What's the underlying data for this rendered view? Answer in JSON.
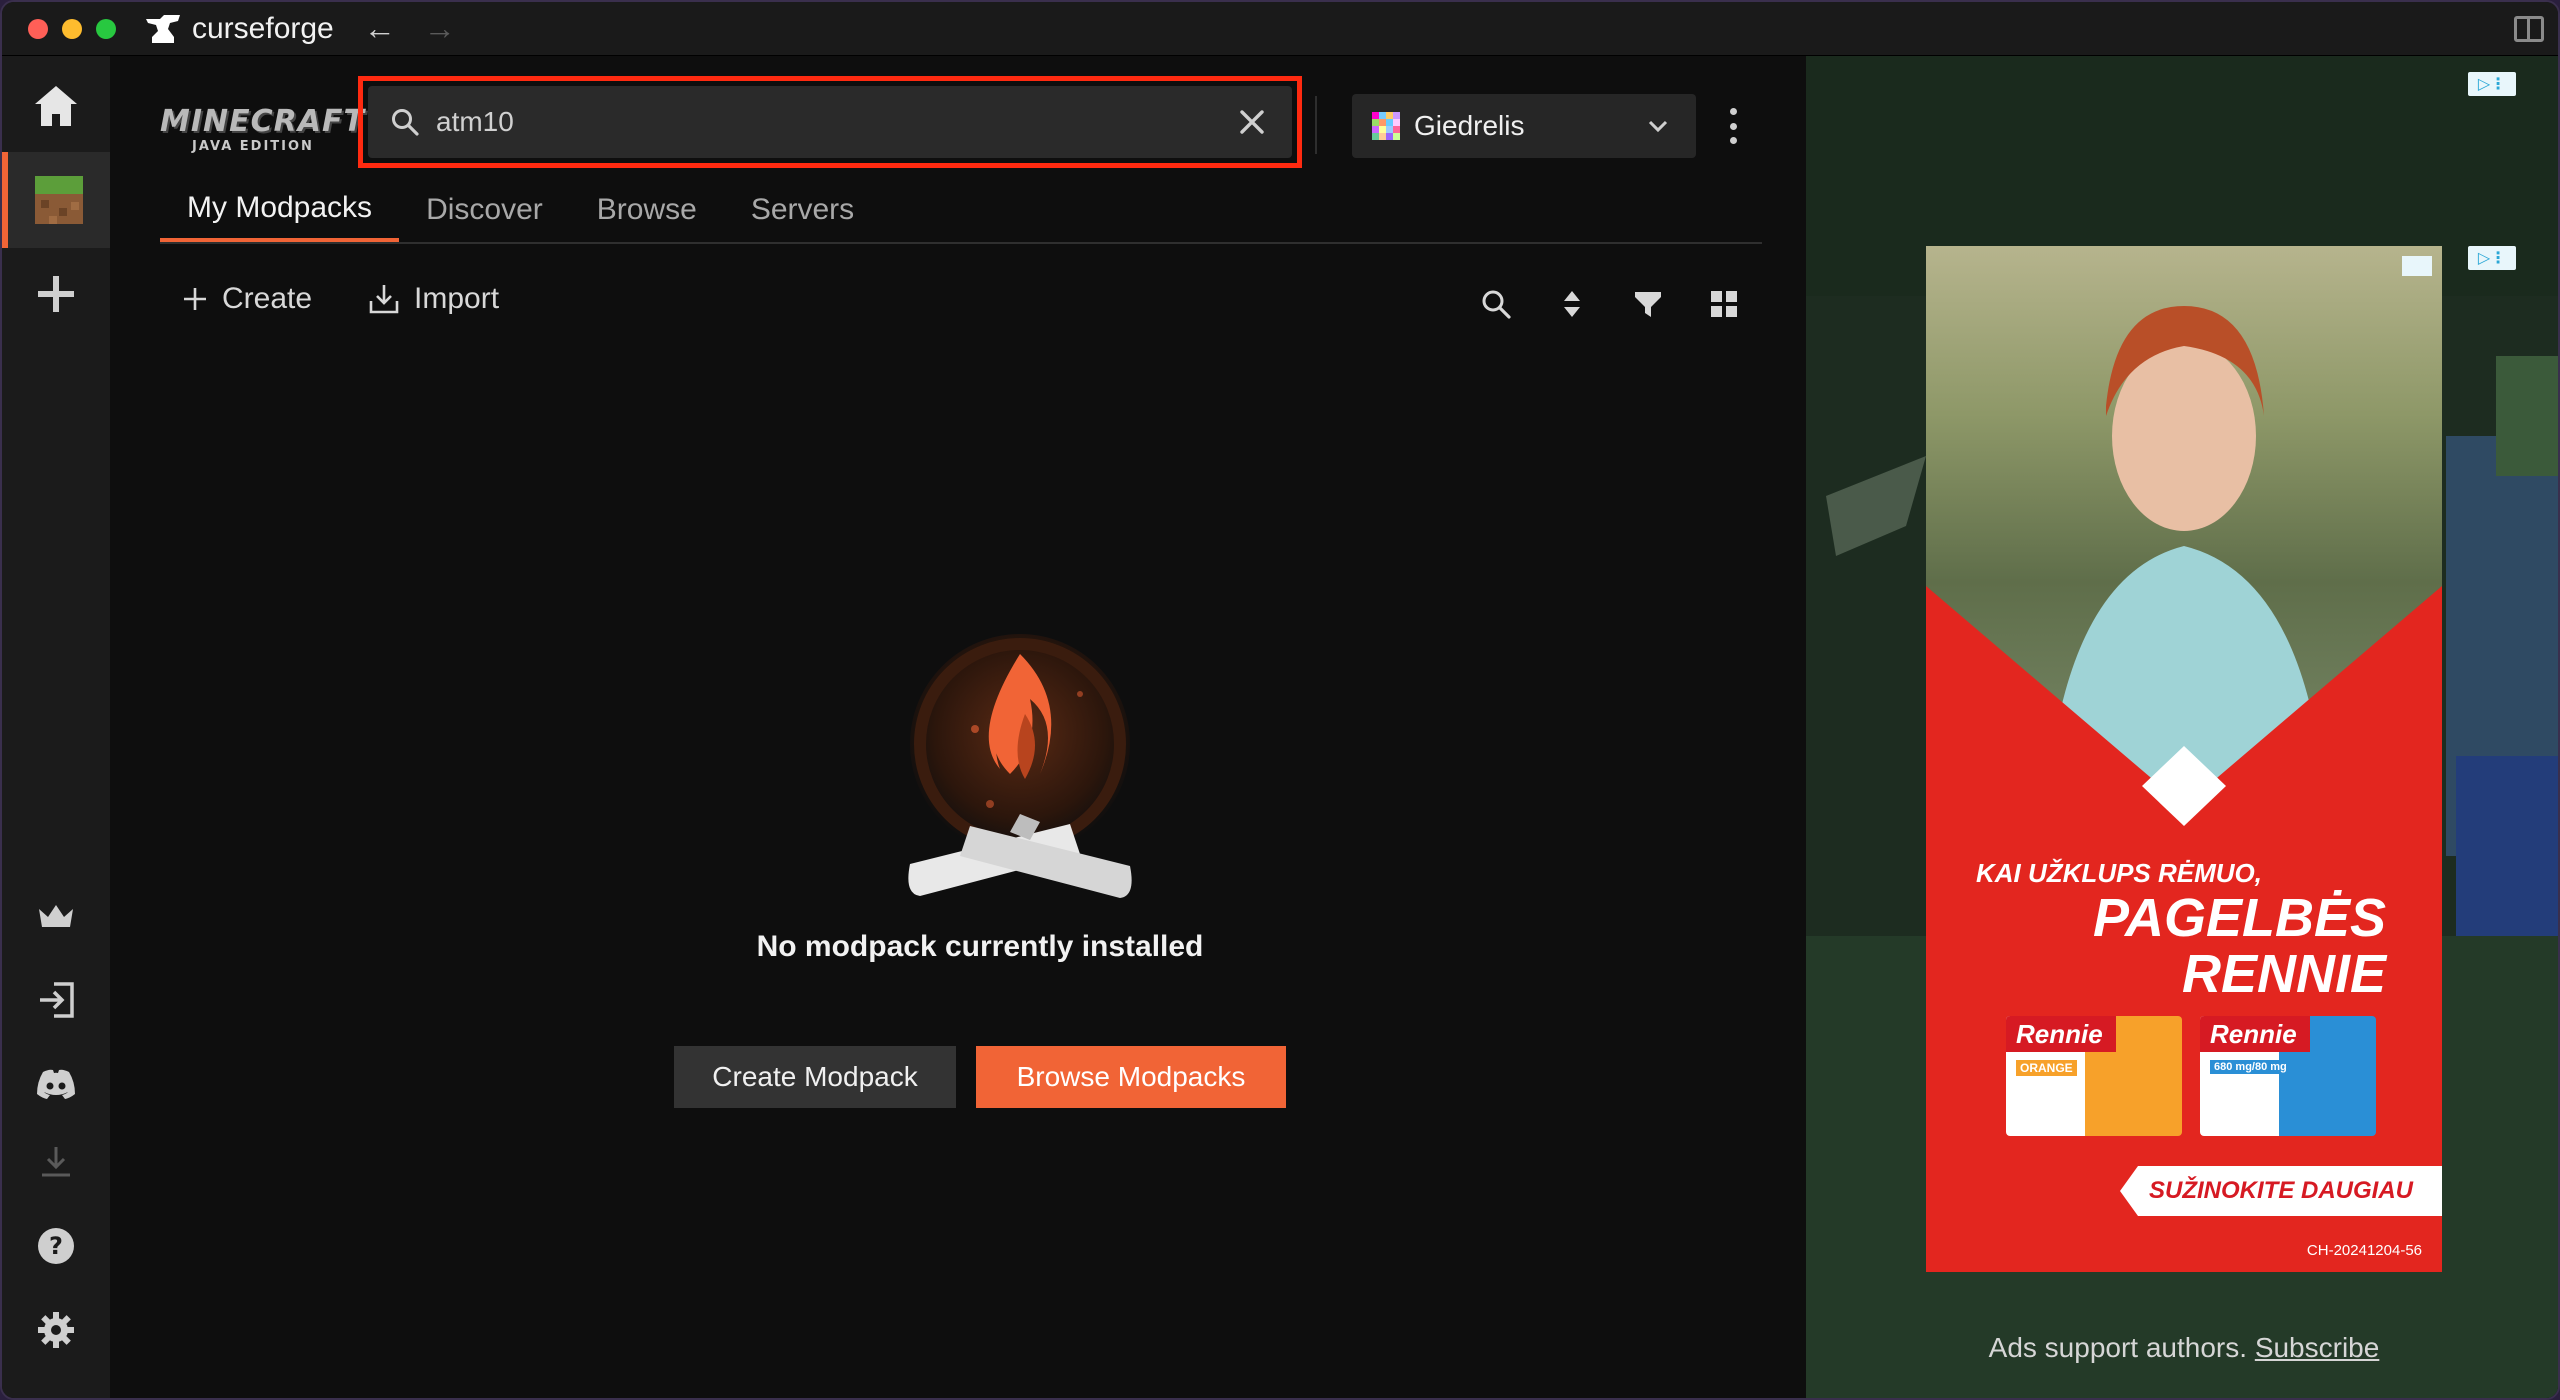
{
  "app": {
    "name": "curseforge"
  },
  "game": {
    "logo_title": "MINECRAFT",
    "logo_subtitle": "JAVA EDITION"
  },
  "search": {
    "value": "atm10",
    "placeholder": ""
  },
  "profile": {
    "name": "Giedrelis"
  },
  "tabs": [
    {
      "label": "My Modpacks",
      "active": true
    },
    {
      "label": "Discover",
      "active": false
    },
    {
      "label": "Browse",
      "active": false
    },
    {
      "label": "Servers",
      "active": false
    }
  ],
  "toolbar": {
    "create_label": "Create",
    "import_label": "Import"
  },
  "empty_state": {
    "title": "No modpack currently installed",
    "create_button": "Create Modpack",
    "browse_button": "Browse Modpacks"
  },
  "ad": {
    "headline_small": "KAI UŽKLUPS RĖMUO,",
    "headline_line1": "PAGELBĖS",
    "headline_line2": "RENNIE",
    "pack_brand": "Rennie",
    "pack1_flavor": "ORANGE",
    "pack2_dose": "680 mg/80 mg",
    "cta": "SUŽINOKITE DAUGIAU",
    "code": "CH-20241204-56"
  },
  "ads_footer": {
    "text": "Ads support authors.",
    "link": "Subscribe"
  },
  "colors": {
    "accent": "#f16436",
    "highlight_outline": "#ff2a10",
    "ad_red": "#e3261f"
  },
  "sidebar_icons": [
    "home-icon",
    "minecraft-grass-icon",
    "plus-icon",
    "crown-icon",
    "login-icon",
    "discord-icon",
    "download-icon",
    "help-icon",
    "settings-icon"
  ]
}
